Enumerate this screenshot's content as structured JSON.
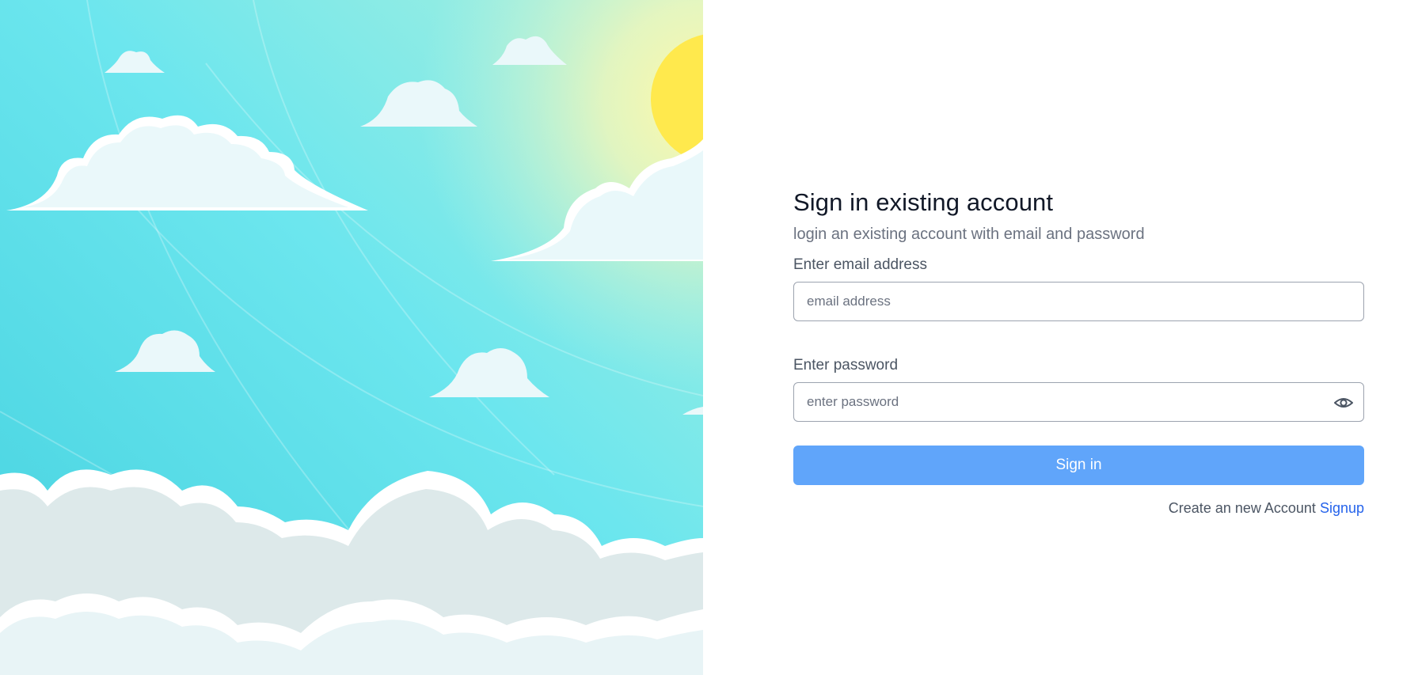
{
  "form": {
    "title": "Sign in existing account",
    "subtitle": "login an existing account with email and password",
    "email": {
      "label": "Enter email address",
      "placeholder": "email address",
      "value": ""
    },
    "password": {
      "label": "Enter password",
      "placeholder": "enter password",
      "value": "",
      "toggle_icon": "eye-icon"
    },
    "submit_label": "Sign in",
    "signup_prompt": "Create an new Account",
    "signup_link": "Signup"
  },
  "colors": {
    "primary_button": "#60a5fa",
    "link": "#2563eb",
    "sky_left": "#4dd6e3",
    "sun": "#ffe94d"
  },
  "illustration": "sky-clouds-sun-illustration"
}
